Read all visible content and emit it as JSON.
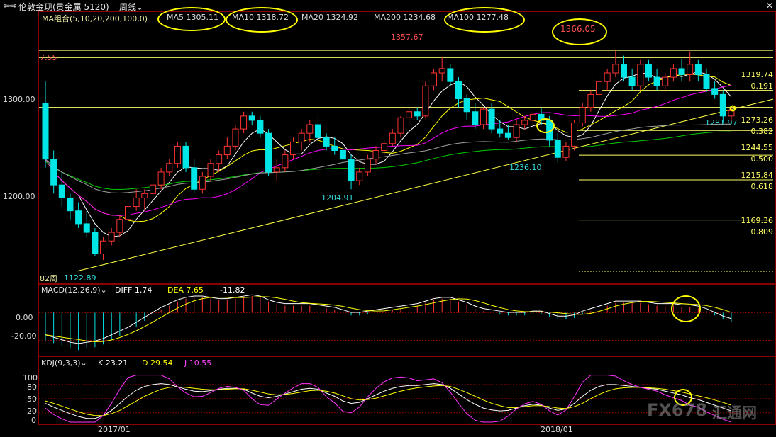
{
  "window": {
    "nav_icon": "back-forward-icon",
    "instrument": "伦敦金现(贵金属 5120)",
    "period_label": "周线"
  },
  "price_pane": {
    "ma_legend": {
      "group": "MA组合(5,10,20,200,100,0)",
      "items": [
        {
          "label": "MA5 1305.11",
          "color": "#ffffff"
        },
        {
          "label": "MA10 1318.72",
          "color": "#ffff00"
        },
        {
          "label": "MA20 1324.92",
          "color": "#ff00ff"
        },
        {
          "label": "MA200 1234.68",
          "color": "#00cc00"
        },
        {
          "label": "MA100 1277.48",
          "color": "#a0a0a0"
        }
      ]
    },
    "y_ticks": [
      "1300.00",
      "1200.00"
    ],
    "price_annotations": {
      "top_left": "7.55",
      "high_2017": "1357.67",
      "high_2018": "1366.05",
      "low_2016": "1122.89",
      "low_mid": "1204.91",
      "low_2017": "1236.10",
      "last_low": "1281.97",
      "bars_count": "82周"
    },
    "fibonacci": [
      {
        "price": "1319.74",
        "ratio": "0.191"
      },
      {
        "price": "1273.26",
        "ratio": "0.382"
      },
      {
        "price": "1244.55",
        "ratio": "0.500"
      },
      {
        "price": "1215.84",
        "ratio": "0.618"
      },
      {
        "price": "1169.36",
        "ratio": "0.809"
      }
    ]
  },
  "macd_pane": {
    "title": "MACD(12,26,9)",
    "diff": "DIFF 1.74",
    "dea": "DEA 7.65",
    "macd": "-11.82",
    "y_ticks": [
      "0.00",
      "-20.00"
    ]
  },
  "kdj_pane": {
    "title": "KDJ(9,3,3)",
    "k": "K 23.21",
    "d": "D 29.54",
    "j": "J 10.55",
    "y_ticks": [
      "100",
      "80",
      "50",
      "20",
      "0"
    ]
  },
  "x_axis": {
    "labels": [
      "2017/01",
      "2018/01"
    ]
  },
  "watermark": {
    "brand": "FX678",
    "cn": "汇通网"
  },
  "chart_data": {
    "type": "candlestick",
    "ylim": [
      1100,
      1400
    ],
    "candles": [
      [
        1305,
        1330,
        1230,
        1240
      ],
      [
        1240,
        1250,
        1200,
        1210
      ],
      [
        1210,
        1225,
        1185,
        1195
      ],
      [
        1195,
        1200,
        1170,
        1180
      ],
      [
        1180,
        1190,
        1160,
        1165
      ],
      [
        1165,
        1180,
        1150,
        1155
      ],
      [
        1155,
        1160,
        1128,
        1130
      ],
      [
        1130,
        1150,
        1123,
        1145
      ],
      [
        1145,
        1160,
        1140,
        1155
      ],
      [
        1155,
        1175,
        1150,
        1170
      ],
      [
        1170,
        1190,
        1165,
        1185
      ],
      [
        1185,
        1205,
        1180,
        1195
      ],
      [
        1195,
        1205,
        1180,
        1200
      ],
      [
        1200,
        1215,
        1195,
        1210
      ],
      [
        1210,
        1230,
        1205,
        1225
      ],
      [
        1225,
        1240,
        1220,
        1235
      ],
      [
        1235,
        1260,
        1230,
        1255
      ],
      [
        1255,
        1260,
        1225,
        1230
      ],
      [
        1230,
        1240,
        1200,
        1205
      ],
      [
        1205,
        1225,
        1200,
        1220
      ],
      [
        1220,
        1240,
        1215,
        1235
      ],
      [
        1235,
        1250,
        1225,
        1245
      ],
      [
        1245,
        1265,
        1240,
        1255
      ],
      [
        1255,
        1280,
        1250,
        1275
      ],
      [
        1275,
        1295,
        1270,
        1290
      ],
      [
        1290,
        1295,
        1280,
        1285
      ],
      [
        1285,
        1290,
        1265,
        1270
      ],
      [
        1270,
        1275,
        1220,
        1225
      ],
      [
        1225,
        1240,
        1215,
        1230
      ],
      [
        1230,
        1250,
        1225,
        1245
      ],
      [
        1245,
        1265,
        1240,
        1260
      ],
      [
        1260,
        1275,
        1250,
        1270
      ],
      [
        1270,
        1285,
        1260,
        1280
      ],
      [
        1280,
        1290,
        1260,
        1265
      ],
      [
        1265,
        1270,
        1250,
        1255
      ],
      [
        1255,
        1265,
        1245,
        1250
      ],
      [
        1250,
        1258,
        1235,
        1240
      ],
      [
        1240,
        1245,
        1205,
        1215
      ],
      [
        1215,
        1230,
        1210,
        1225
      ],
      [
        1225,
        1245,
        1220,
        1240
      ],
      [
        1240,
        1255,
        1235,
        1250
      ],
      [
        1250,
        1262,
        1245,
        1258
      ],
      [
        1258,
        1275,
        1255,
        1270
      ],
      [
        1270,
        1290,
        1265,
        1288
      ],
      [
        1288,
        1300,
        1280,
        1295
      ],
      [
        1295,
        1300,
        1285,
        1290
      ],
      [
        1290,
        1330,
        1288,
        1325
      ],
      [
        1325,
        1345,
        1320,
        1340
      ],
      [
        1340,
        1358,
        1330,
        1345
      ],
      [
        1345,
        1350,
        1325,
        1330
      ],
      [
        1330,
        1335,
        1300,
        1310
      ],
      [
        1310,
        1315,
        1285,
        1295
      ],
      [
        1295,
        1305,
        1275,
        1280
      ],
      [
        1280,
        1300,
        1275,
        1298
      ],
      [
        1298,
        1305,
        1270,
        1275
      ],
      [
        1275,
        1285,
        1265,
        1270
      ],
      [
        1270,
        1280,
        1262,
        1265
      ],
      [
        1265,
        1285,
        1260,
        1280
      ],
      [
        1280,
        1290,
        1275,
        1285
      ],
      [
        1285,
        1295,
        1280,
        1292
      ],
      [
        1292,
        1300,
        1280,
        1285
      ],
      [
        1285,
        1290,
        1255,
        1262
      ],
      [
        1262,
        1270,
        1236,
        1242
      ],
      [
        1242,
        1260,
        1238,
        1255
      ],
      [
        1255,
        1285,
        1250,
        1282
      ],
      [
        1282,
        1305,
        1278,
        1300
      ],
      [
        1300,
        1320,
        1295,
        1315
      ],
      [
        1315,
        1335,
        1310,
        1330
      ],
      [
        1330,
        1345,
        1320,
        1340
      ],
      [
        1340,
        1366,
        1335,
        1350
      ],
      [
        1350,
        1360,
        1330,
        1335
      ],
      [
        1335,
        1345,
        1320,
        1325
      ],
      [
        1325,
        1355,
        1320,
        1350
      ],
      [
        1350,
        1355,
        1330,
        1335
      ],
      [
        1335,
        1345,
        1320,
        1325
      ],
      [
        1325,
        1340,
        1318,
        1335
      ],
      [
        1335,
        1350,
        1330,
        1345
      ],
      [
        1345,
        1356,
        1330,
        1338
      ],
      [
        1338,
        1365,
        1330,
        1350
      ],
      [
        1350,
        1355,
        1330,
        1338
      ],
      [
        1338,
        1345,
        1318,
        1322
      ],
      [
        1322,
        1330,
        1310,
        1315
      ],
      [
        1315,
        1320,
        1282,
        1290
      ],
      [
        1290,
        1300,
        1282,
        1296
      ]
    ],
    "reference_lines": [
      1357.67,
      1366.05,
      1319.74,
      1300,
      1273.26,
      1244.55,
      1215.84,
      1169.36
    ],
    "macd_hist": [
      -20,
      -22,
      -24,
      -26,
      -27,
      -26,
      -25,
      -23,
      -20,
      -17,
      -14,
      -10,
      -6,
      -2,
      2,
      5,
      8,
      10,
      11,
      11,
      10,
      9,
      9,
      10,
      11,
      12,
      11,
      8,
      6,
      5,
      5,
      5,
      5,
      4,
      3,
      2,
      0,
      -2,
      -2,
      -1,
      0,
      1,
      2,
      3,
      4,
      5,
      7,
      9,
      10,
      10,
      8,
      6,
      3,
      1,
      0,
      -1,
      -2,
      -2,
      -2,
      -1,
      -1,
      -3,
      -5,
      -5,
      -4,
      -1,
      1,
      3,
      5,
      7,
      7,
      7,
      7,
      6,
      5,
      5,
      5,
      4,
      4,
      3,
      1,
      -2,
      -5,
      -7
    ],
    "macd_ylim": [
      -30,
      15
    ],
    "kdj_ylim": [
      0,
      110
    ],
    "kdj_k": [
      40,
      32,
      25,
      18,
      12,
      8,
      8,
      14,
      25,
      40,
      55,
      68,
      76,
      80,
      82,
      80,
      75,
      70,
      66,
      65,
      67,
      70,
      72,
      72,
      70,
      62,
      55,
      52,
      55,
      60,
      65,
      70,
      72,
      70,
      62,
      55,
      45,
      40,
      42,
      50,
      58,
      66,
      72,
      76,
      78,
      78,
      80,
      82,
      80,
      72,
      60,
      48,
      38,
      30,
      26,
      24,
      25,
      30,
      35,
      38,
      36,
      30,
      25,
      28,
      40,
      55,
      68,
      76,
      80,
      80,
      78,
      76,
      74,
      72,
      70,
      66,
      62,
      58,
      52,
      48,
      42,
      36,
      30,
      24
    ],
    "kdj_d": [
      45,
      40,
      34,
      28,
      22,
      17,
      14,
      14,
      18,
      25,
      35,
      45,
      55,
      63,
      70,
      74,
      75,
      74,
      72,
      70,
      69,
      69,
      70,
      71,
      71,
      68,
      64,
      60,
      58,
      59,
      61,
      64,
      67,
      68,
      66,
      62,
      56,
      50,
      47,
      48,
      51,
      56,
      61,
      66,
      70,
      73,
      75,
      77,
      78,
      76,
      70,
      63,
      55,
      47,
      40,
      35,
      31,
      31,
      33,
      35,
      35,
      33,
      30,
      29,
      33,
      40,
      50,
      59,
      66,
      71,
      73,
      74,
      74,
      73,
      72,
      70,
      67,
      64,
      60,
      56,
      52,
      47,
      42,
      36
    ],
    "kdj_j": [
      30,
      16,
      7,
      0,
      0,
      0,
      0,
      14,
      40,
      70,
      95,
      100,
      100,
      100,
      100,
      92,
      75,
      62,
      54,
      55,
      63,
      72,
      76,
      74,
      68,
      50,
      37,
      36,
      49,
      62,
      73,
      82,
      82,
      74,
      54,
      41,
      23,
      20,
      32,
      54,
      72,
      86,
      94,
      96,
      94,
      88,
      90,
      92,
      84,
      64,
      40,
      18,
      4,
      0,
      0,
      2,
      13,
      28,
      39,
      44,
      38,
      24,
      15,
      26,
      54,
      85,
      100,
      100,
      100,
      98,
      88,
      80,
      74,
      70,
      66,
      58,
      52,
      46,
      36,
      32,
      22,
      14,
      6,
      0
    ]
  }
}
